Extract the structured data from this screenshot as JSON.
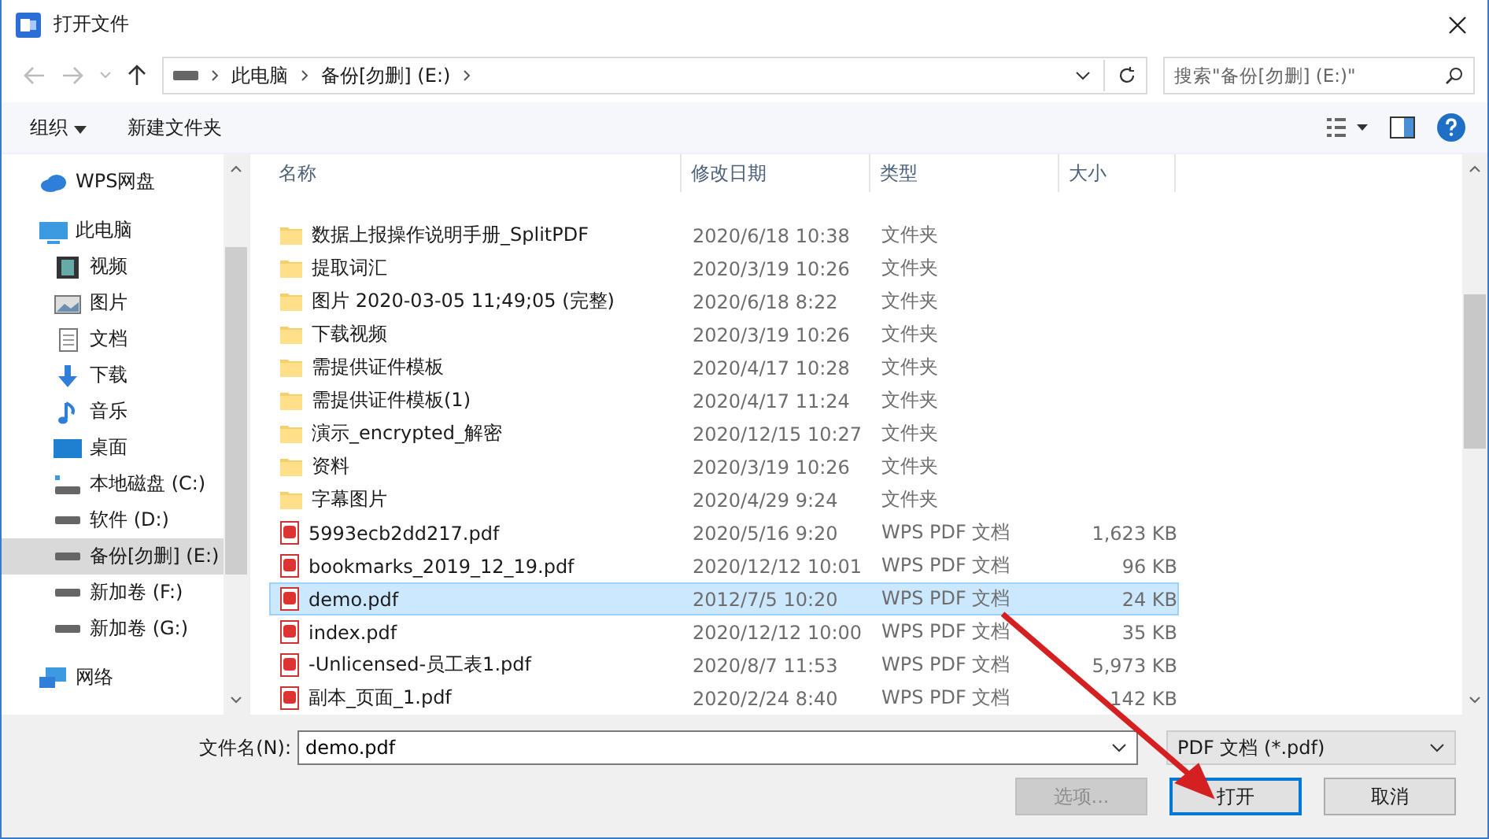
{
  "window": {
    "title": "打开文件"
  },
  "address": {
    "path": [
      "此电脑",
      "备份[勿删] (E:)"
    ],
    "search_placeholder": "搜索\"备份[勿删] (E:)\""
  },
  "toolbar": {
    "organize": "组织",
    "new_folder": "新建文件夹"
  },
  "sidebar": {
    "items": [
      {
        "label": "WPS网盘",
        "kind": "cloud",
        "selected": false
      },
      {
        "label": "此电脑",
        "kind": "pc",
        "selected": false,
        "children": [
          {
            "label": "视频",
            "kind": "video",
            "selected": false
          },
          {
            "label": "图片",
            "kind": "picture",
            "selected": false
          },
          {
            "label": "文档",
            "kind": "document",
            "selected": false
          },
          {
            "label": "下载",
            "kind": "download",
            "selected": false
          },
          {
            "label": "音乐",
            "kind": "music",
            "selected": false
          },
          {
            "label": "桌面",
            "kind": "desktop",
            "selected": false
          },
          {
            "label": "本地磁盘 (C:)",
            "kind": "system-drive",
            "selected": false
          },
          {
            "label": "软件 (D:)",
            "kind": "drive",
            "selected": false
          },
          {
            "label": "备份[勿删] (E:)",
            "kind": "drive",
            "selected": true
          },
          {
            "label": "新加卷 (F:)",
            "kind": "drive",
            "selected": false
          },
          {
            "label": "新加卷 (G:)",
            "kind": "drive",
            "selected": false
          }
        ]
      },
      {
        "label": "网络",
        "kind": "network",
        "selected": false
      }
    ]
  },
  "table": {
    "columns": [
      "名称",
      "修改日期",
      "类型",
      "大小"
    ],
    "rows": [
      {
        "name": "数据上报操作说明手册_SplitPDF",
        "date": "2020/6/18 10:38",
        "type": "文件夹",
        "size": "",
        "kind": "folder",
        "selected": false
      },
      {
        "name": "提取词汇",
        "date": "2020/3/19 10:26",
        "type": "文件夹",
        "size": "",
        "kind": "folder",
        "selected": false
      },
      {
        "name": "图片 2020-03-05 11;49;05 (完整)",
        "date": "2020/6/18 8:22",
        "type": "文件夹",
        "size": "",
        "kind": "folder",
        "selected": false
      },
      {
        "name": "下载视频",
        "date": "2020/3/19 10:26",
        "type": "文件夹",
        "size": "",
        "kind": "folder",
        "selected": false
      },
      {
        "name": "需提供证件模板",
        "date": "2020/4/17 10:28",
        "type": "文件夹",
        "size": "",
        "kind": "folder",
        "selected": false
      },
      {
        "name": "需提供证件模板(1)",
        "date": "2020/4/17 11:24",
        "type": "文件夹",
        "size": "",
        "kind": "folder",
        "selected": false
      },
      {
        "name": "演示_encrypted_解密",
        "date": "2020/12/15 10:27",
        "type": "文件夹",
        "size": "",
        "kind": "folder",
        "selected": false
      },
      {
        "name": "资料",
        "date": "2020/3/19 10:26",
        "type": "文件夹",
        "size": "",
        "kind": "folder",
        "selected": false
      },
      {
        "name": "字幕图片",
        "date": "2020/4/29 9:24",
        "type": "文件夹",
        "size": "",
        "kind": "folder",
        "selected": false
      },
      {
        "name": "5993ecb2dd217.pdf",
        "date": "2020/5/16 9:20",
        "type": "WPS PDF 文档",
        "size": "1,623 KB",
        "kind": "pdf",
        "selected": false
      },
      {
        "name": "bookmarks_2019_12_19.pdf",
        "date": "2020/12/12 10:01",
        "type": "WPS PDF 文档",
        "size": "96 KB",
        "kind": "pdf",
        "selected": false
      },
      {
        "name": "demo.pdf",
        "date": "2012/7/5 10:20",
        "type": "WPS PDF 文档",
        "size": "24 KB",
        "kind": "pdf",
        "selected": true
      },
      {
        "name": "index.pdf",
        "date": "2020/12/12 10:00",
        "type": "WPS PDF 文档",
        "size": "35 KB",
        "kind": "pdf",
        "selected": false
      },
      {
        "name": "-Unlicensed-员工表1.pdf",
        "date": "2020/8/7 11:53",
        "type": "WPS PDF 文档",
        "size": "5,973 KB",
        "kind": "pdf",
        "selected": false
      },
      {
        "name": "副本_页面_1.pdf",
        "date": "2020/2/24 8:40",
        "type": "WPS PDF 文档",
        "size": "142 KB",
        "kind": "pdf",
        "selected": false
      }
    ]
  },
  "footer": {
    "filename_label": "文件名(N):",
    "filename": "demo.pdf",
    "filter": "PDF 文档 (*.pdf)",
    "options": "选项...",
    "options_disabled": true,
    "open": "打开",
    "cancel": "取消"
  }
}
